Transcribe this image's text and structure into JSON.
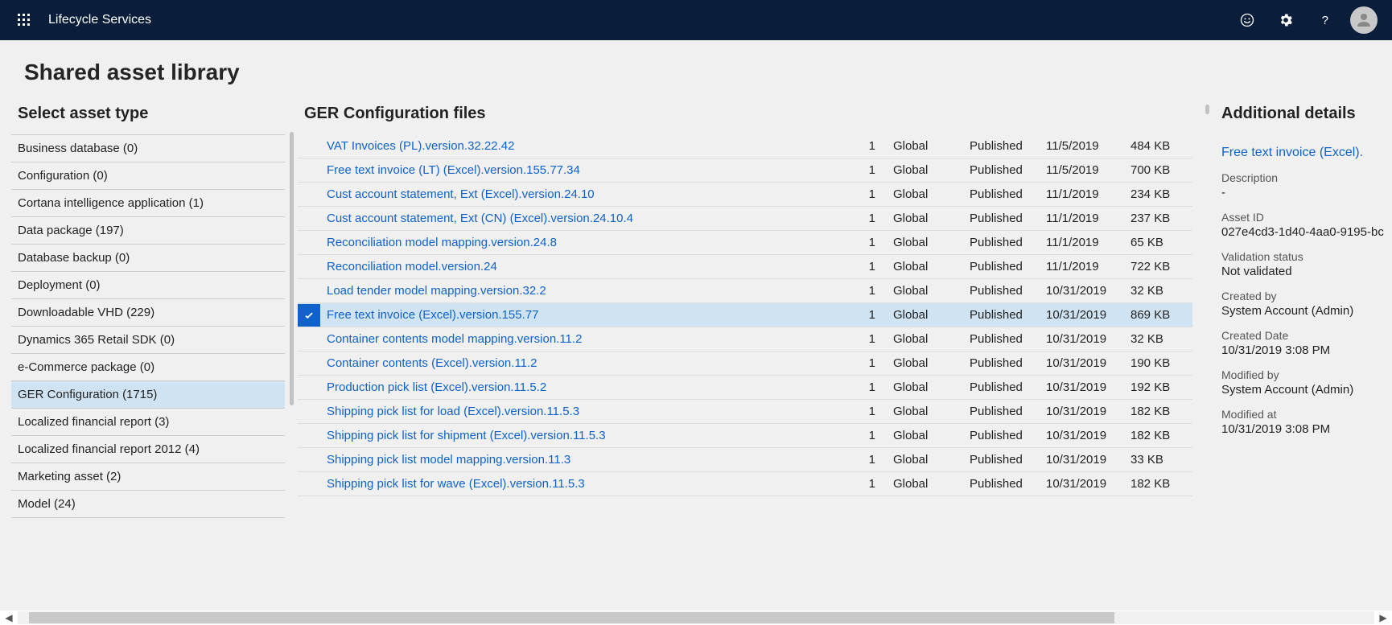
{
  "header": {
    "app_title": "Lifecycle Services"
  },
  "page": {
    "heading": "Shared asset library",
    "left_panel_title": "Select asset type",
    "center_panel_title": "GER Configuration files",
    "right_panel_title": "Additional details"
  },
  "asset_types": [
    {
      "label": "Business database (0)",
      "selected": false
    },
    {
      "label": "Configuration (0)",
      "selected": false
    },
    {
      "label": "Cortana intelligence application (1)",
      "selected": false
    },
    {
      "label": "Data package (197)",
      "selected": false
    },
    {
      "label": "Database backup (0)",
      "selected": false
    },
    {
      "label": "Deployment (0)",
      "selected": false
    },
    {
      "label": "Downloadable VHD (229)",
      "selected": false
    },
    {
      "label": "Dynamics 365 Retail SDK (0)",
      "selected": false
    },
    {
      "label": "e-Commerce package (0)",
      "selected": false
    },
    {
      "label": "GER Configuration (1715)",
      "selected": true
    },
    {
      "label": "Localized financial report (3)",
      "selected": false
    },
    {
      "label": "Localized financial report 2012 (4)",
      "selected": false
    },
    {
      "label": "Marketing asset (2)",
      "selected": false
    },
    {
      "label": "Model (24)",
      "selected": false
    }
  ],
  "files": [
    {
      "name": "VAT Invoices (PL).version.32.22.42",
      "count": "1",
      "scope": "Global",
      "status": "Published",
      "date": "11/5/2019",
      "size": "484 KB",
      "selected": false
    },
    {
      "name": "Free text invoice (LT) (Excel).version.155.77.34",
      "count": "1",
      "scope": "Global",
      "status": "Published",
      "date": "11/5/2019",
      "size": "700 KB",
      "selected": false
    },
    {
      "name": "Cust account statement, Ext (Excel).version.24.10",
      "count": "1",
      "scope": "Global",
      "status": "Published",
      "date": "11/1/2019",
      "size": "234 KB",
      "selected": false
    },
    {
      "name": "Cust account statement, Ext (CN) (Excel).version.24.10.4",
      "count": "1",
      "scope": "Global",
      "status": "Published",
      "date": "11/1/2019",
      "size": "237 KB",
      "selected": false
    },
    {
      "name": "Reconciliation model mapping.version.24.8",
      "count": "1",
      "scope": "Global",
      "status": "Published",
      "date": "11/1/2019",
      "size": "65 KB",
      "selected": false
    },
    {
      "name": "Reconciliation model.version.24",
      "count": "1",
      "scope": "Global",
      "status": "Published",
      "date": "11/1/2019",
      "size": "722 KB",
      "selected": false
    },
    {
      "name": "Load tender model mapping.version.32.2",
      "count": "1",
      "scope": "Global",
      "status": "Published",
      "date": "10/31/2019",
      "size": "32 KB",
      "selected": false
    },
    {
      "name": "Free text invoice (Excel).version.155.77",
      "count": "1",
      "scope": "Global",
      "status": "Published",
      "date": "10/31/2019",
      "size": "869 KB",
      "selected": true
    },
    {
      "name": "Container contents model mapping.version.11.2",
      "count": "1",
      "scope": "Global",
      "status": "Published",
      "date": "10/31/2019",
      "size": "32 KB",
      "selected": false
    },
    {
      "name": "Container contents (Excel).version.11.2",
      "count": "1",
      "scope": "Global",
      "status": "Published",
      "date": "10/31/2019",
      "size": "190 KB",
      "selected": false
    },
    {
      "name": "Production pick list (Excel).version.11.5.2",
      "count": "1",
      "scope": "Global",
      "status": "Published",
      "date": "10/31/2019",
      "size": "192 KB",
      "selected": false
    },
    {
      "name": "Shipping pick list for load (Excel).version.11.5.3",
      "count": "1",
      "scope": "Global",
      "status": "Published",
      "date": "10/31/2019",
      "size": "182 KB",
      "selected": false
    },
    {
      "name": "Shipping pick list for shipment (Excel).version.11.5.3",
      "count": "1",
      "scope": "Global",
      "status": "Published",
      "date": "10/31/2019",
      "size": "182 KB",
      "selected": false
    },
    {
      "name": "Shipping pick list model mapping.version.11.3",
      "count": "1",
      "scope": "Global",
      "status": "Published",
      "date": "10/31/2019",
      "size": "33 KB",
      "selected": false
    },
    {
      "name": "Shipping pick list for wave (Excel).version.11.5.3",
      "count": "1",
      "scope": "Global",
      "status": "Published",
      "date": "10/31/2019",
      "size": "182 KB",
      "selected": false
    }
  ],
  "details": {
    "title": "Free text invoice (Excel).",
    "description_label": "Description",
    "description_value": "-",
    "asset_id_label": "Asset ID",
    "asset_id_value": "027e4cd3-1d40-4aa0-9195-bc",
    "validation_label": "Validation status",
    "validation_value": "Not validated",
    "created_by_label": "Created by",
    "created_by_value": "System Account (Admin)",
    "created_date_label": "Created Date",
    "created_date_value": "10/31/2019 3:08 PM",
    "modified_by_label": "Modified by",
    "modified_by_value": "System Account (Admin)",
    "modified_at_label": "Modified at",
    "modified_at_value": "10/31/2019 3:08 PM"
  }
}
